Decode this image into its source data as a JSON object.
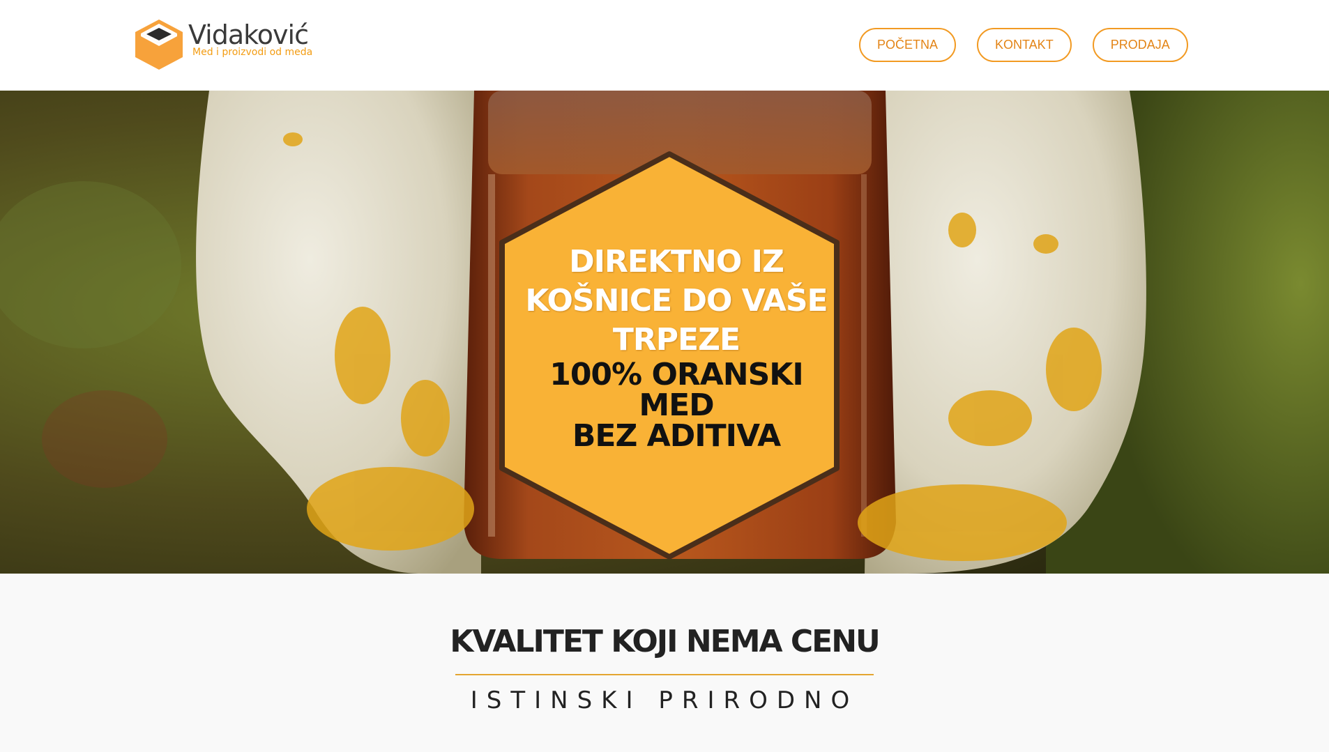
{
  "brand": {
    "name": "Vidaković",
    "tagline": "Med i proizvodi od meda",
    "colors": {
      "accent": "#f29a22",
      "logo_orange": "#f7a23b",
      "logo_dark": "#2b2b2b"
    }
  },
  "nav": {
    "items": [
      {
        "label": "POČETNA"
      },
      {
        "label": "KONTAKT"
      },
      {
        "label": "PRODAJA"
      }
    ]
  },
  "hero": {
    "badge": {
      "line1": "DIREKTNO IZ",
      "line2": "KOŠNICE DO VAŠE",
      "line3": "TRPEZE",
      "line4": "100% ORANSKI",
      "line5": "MED",
      "line6": "BEZ ADITIVA",
      "fill_color": "#f9b236",
      "border_color": "#4a2e1a"
    },
    "photo_subject": "gloved hands holding a jar of honey"
  },
  "intro": {
    "title": "KVALITET KOJI NEMA CENU",
    "subtitle": "ISTINSKI PRIRODNO",
    "rule_color": "#e4a530"
  }
}
